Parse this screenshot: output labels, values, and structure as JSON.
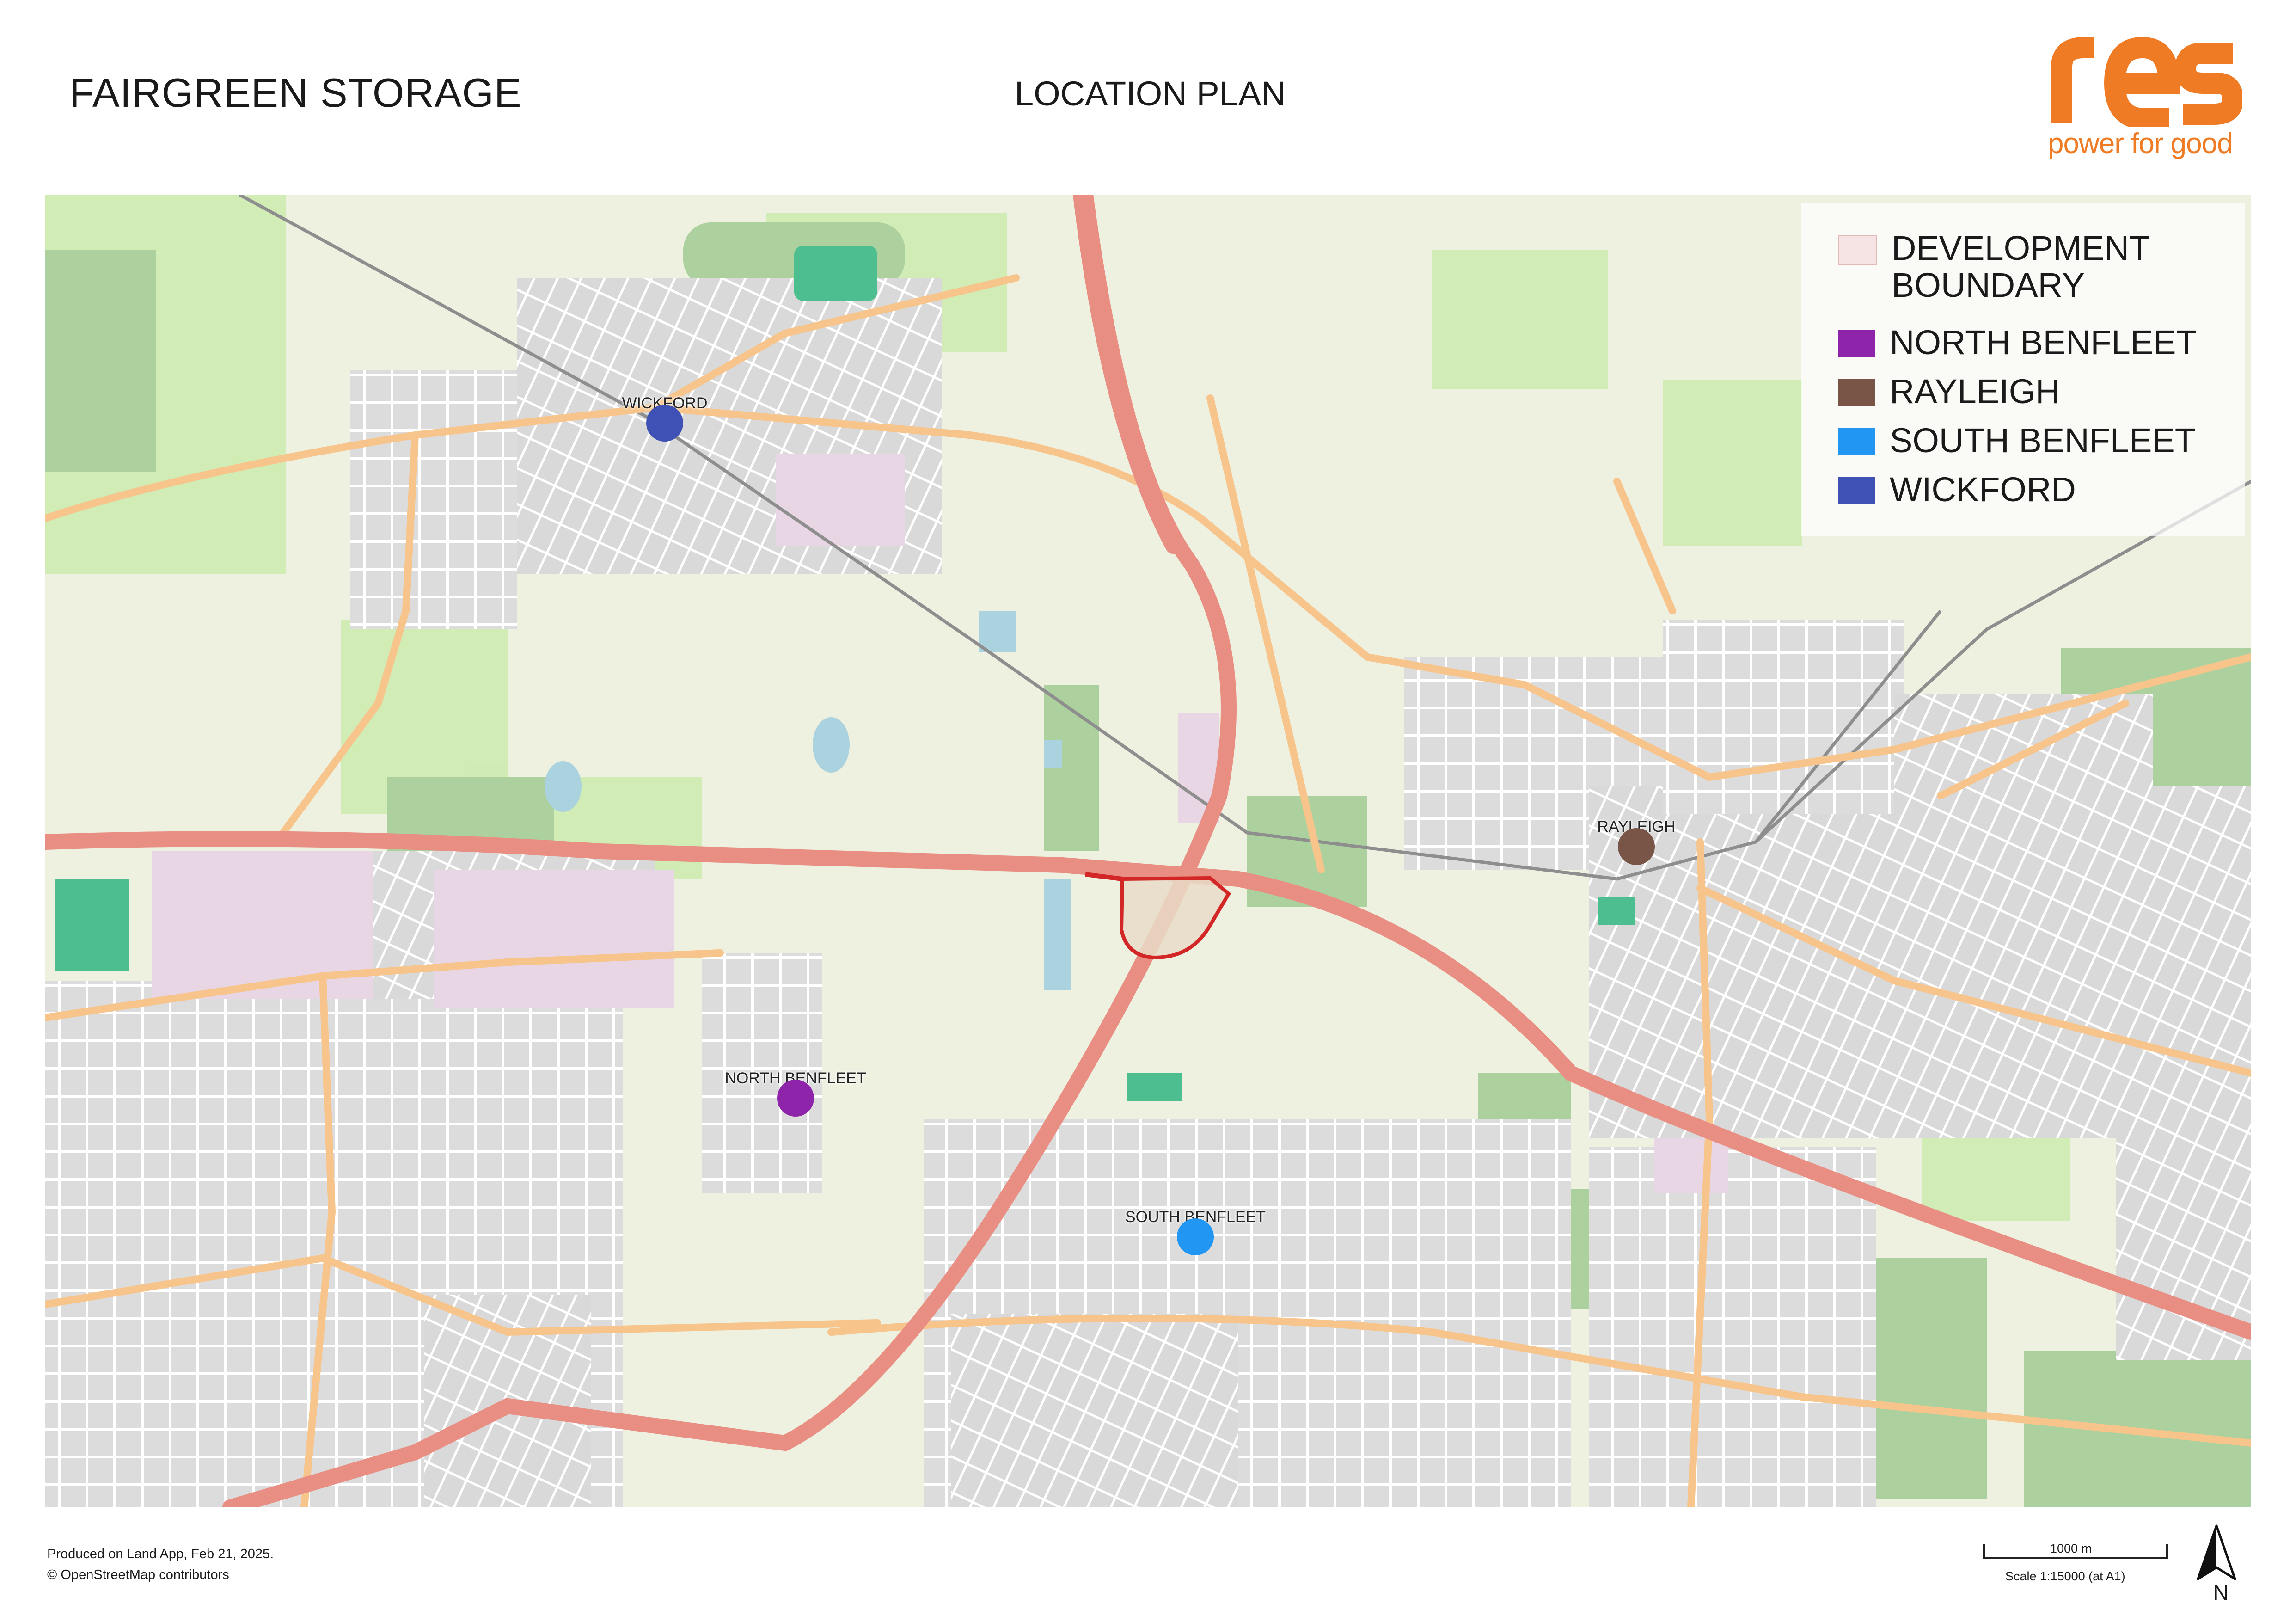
{
  "header": {
    "title": "FAIRGREEN STORAGE",
    "subtitle": "LOCATION PLAN",
    "logo_word": "res",
    "logo_tagline": "power for good",
    "logo_color": "#f07b25"
  },
  "legend": {
    "items": [
      {
        "label": "DEVELOPMENT BOUNDARY",
        "color": "#f6e3e3"
      },
      {
        "label": "NORTH BENFLEET",
        "color": "#8e24aa"
      },
      {
        "label": "RAYLEIGH",
        "color": "#795548"
      },
      {
        "label": "SOUTH BENFLEET",
        "color": "#2196f3"
      },
      {
        "label": "WICKFORD",
        "color": "#3f51b5"
      }
    ]
  },
  "places": {
    "wickford": {
      "label": "WICKFORD",
      "color": "#3f51b5"
    },
    "rayleigh": {
      "label": "RAYLEIGH",
      "color": "#795548"
    },
    "north_benfleet": {
      "label": "NORTH BENFLEET",
      "color": "#8e24aa"
    },
    "south_benfleet": {
      "label": "SOUTH BENFLEET",
      "color": "#2196f3"
    }
  },
  "footer": {
    "produced": "Produced on Land App, Feb 21, 2025.",
    "attribution": "© OpenStreetMap contributors"
  },
  "scale": {
    "distance_label": "1000 m",
    "ratio_label": "Scale 1:15000 (at A1)"
  },
  "north_arrow": {
    "label": "N"
  }
}
